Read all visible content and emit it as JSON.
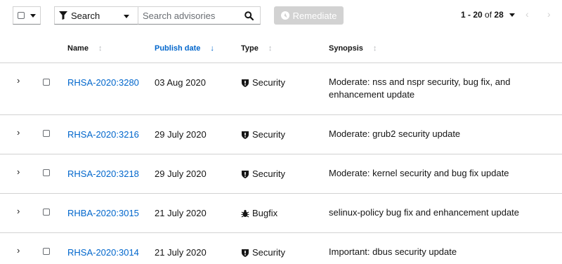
{
  "toolbar": {
    "filter_label": "Search",
    "search_placeholder": "Search advisories",
    "remediate_label": "Remediate"
  },
  "pagination": {
    "range": "1 - 20",
    "of_label": "of",
    "total": "28",
    "prev_icon": "‹",
    "next_icon": "›"
  },
  "table": {
    "columns": [
      "Name",
      "Publish date",
      "Type",
      "Synopsis"
    ],
    "sorted_column": "Publish date",
    "rows": [
      {
        "name": "RHSA-2020:3280",
        "date": "03 Aug 2020",
        "type": "Security",
        "type_icon": "shield-icon",
        "synopsis": "Moderate: nss and nspr security, bug fix, and enhancement update"
      },
      {
        "name": "RHSA-2020:3216",
        "date": "29 July 2020",
        "type": "Security",
        "type_icon": "shield-icon",
        "synopsis": "Moderate: grub2 security update"
      },
      {
        "name": "RHSA-2020:3218",
        "date": "29 July 2020",
        "type": "Security",
        "type_icon": "shield-icon",
        "synopsis": "Moderate: kernel security and bug fix update"
      },
      {
        "name": "RHBA-2020:3015",
        "date": "21 July 2020",
        "type": "Bugfix",
        "type_icon": "bug-icon",
        "synopsis": "selinux-policy bug fix and enhancement update"
      },
      {
        "name": "RHSA-2020:3014",
        "date": "21 July 2020",
        "type": "Security",
        "type_icon": "shield-icon",
        "synopsis": "Important: dbus security update"
      }
    ]
  },
  "colors": {
    "link": "#0066cc",
    "disabled_button": "#d2d2d2",
    "border": "#d2d2d2"
  }
}
